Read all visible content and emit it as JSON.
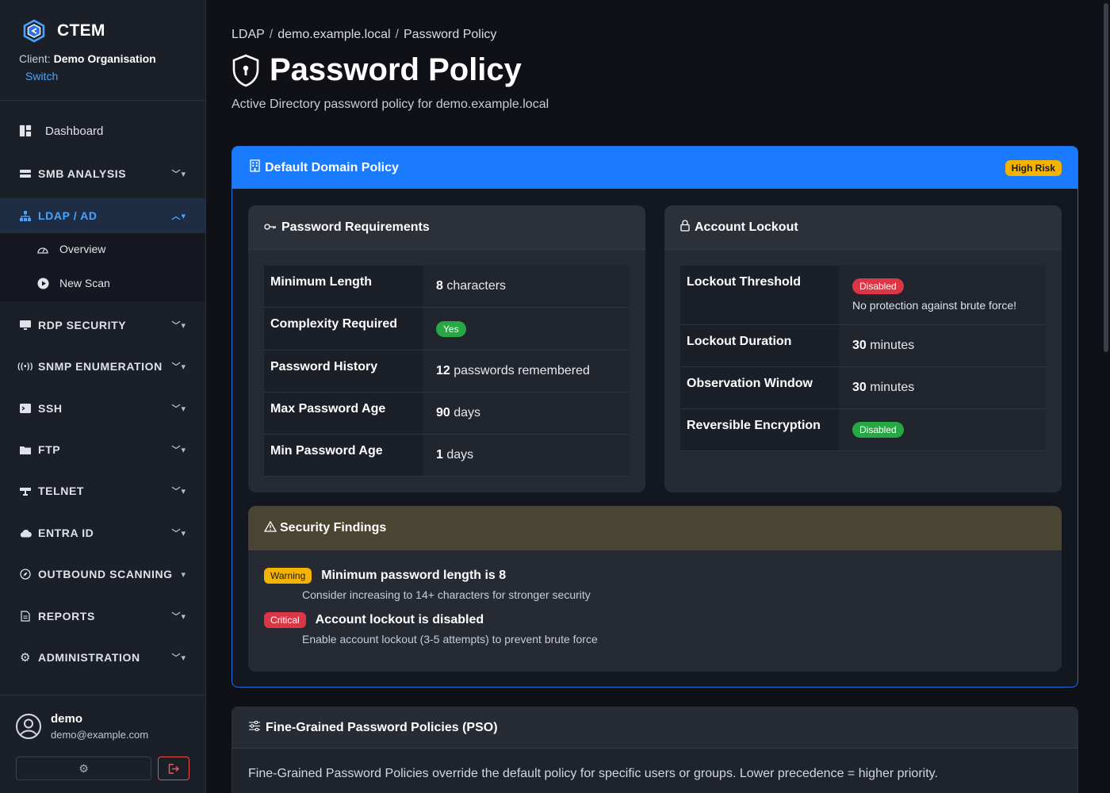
{
  "brand": {
    "name": "CTEM"
  },
  "client": {
    "label": "Client:",
    "name": "Demo Organisation",
    "switch_label": "Switch"
  },
  "nav": {
    "dashboard": "Dashboard",
    "smb": "SMB ANALYSIS",
    "ldap": "LDAP / AD",
    "ldap_overview": "Overview",
    "ldap_new_scan": "New Scan",
    "rdp": "RDP SECURITY",
    "snmp": "SNMP ENUMERATION",
    "ssh": "SSH",
    "ftp": "FTP",
    "telnet": "TELNET",
    "entra": "ENTRA ID",
    "outbound": "OUTBOUND SCANNING",
    "reports": "REPORTS",
    "admin": "ADMINISTRATION"
  },
  "user": {
    "name": "demo",
    "email": "demo@example.com"
  },
  "breadcrumb": [
    "LDAP",
    "demo.example.local",
    "Password Policy"
  ],
  "page": {
    "title": "Password Policy",
    "subtitle": "Active Directory password policy for demo.example.local"
  },
  "policy": {
    "title": "Default Domain Policy",
    "risk_badge": "High Risk",
    "requirements": {
      "title": "Password Requirements",
      "rows": [
        {
          "key": "Minimum Length",
          "value": "8",
          "unit": "characters"
        },
        {
          "key": "Complexity Required",
          "badge": "Yes"
        },
        {
          "key": "Password History",
          "value": "12",
          "unit": "passwords remembered"
        },
        {
          "key": "Max Password Age",
          "value": "90",
          "unit": "days"
        },
        {
          "key": "Min Password Age",
          "value": "1",
          "unit": "days"
        }
      ]
    },
    "lockout": {
      "title": "Account Lockout",
      "threshold_key": "Lockout Threshold",
      "threshold_badge": "Disabled",
      "threshold_note": "No protection against brute force!",
      "duration_key": "Lockout Duration",
      "duration_value": "30",
      "duration_unit": "minutes",
      "window_key": "Observation Window",
      "window_value": "30",
      "window_unit": "minutes",
      "reversible_key": "Reversible Encryption",
      "reversible_badge": "Disabled"
    },
    "findings": {
      "title": "Security Findings",
      "items": [
        {
          "severity": "Warning",
          "title": "Minimum password length is 8",
          "desc": "Consider increasing to 14+ characters for stronger security"
        },
        {
          "severity": "Critical",
          "title": "Account lockout is disabled",
          "desc": "Enable account lockout (3-5 attempts) to prevent brute force"
        }
      ]
    }
  },
  "pso": {
    "title": "Fine-Grained Password Policies (PSO)",
    "text": "Fine-Grained Password Policies override the default policy for specific users or groups. Lower precedence = higher priority."
  },
  "colors": {
    "accent": "#1a7bff",
    "link": "#4aa3ff",
    "warning": "#f5b301",
    "danger": "#dc3545",
    "success": "#28a745"
  }
}
